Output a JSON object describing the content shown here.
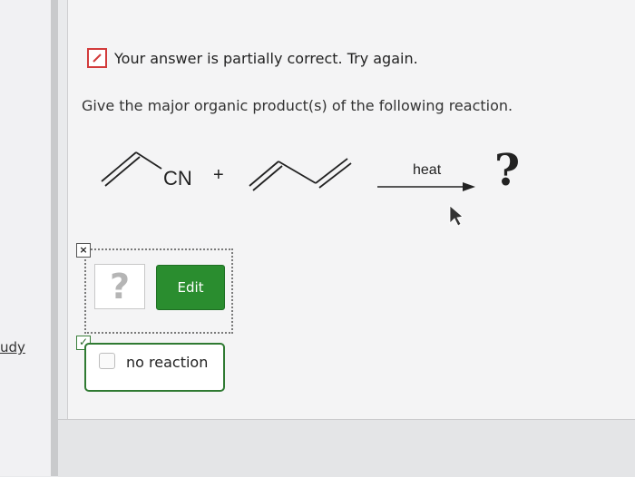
{
  "sidebar": {
    "fragment_text": "udy"
  },
  "status": {
    "message": "Your answer is partially correct.  Try again."
  },
  "question": {
    "text": "Give the major organic product(s) of the following reaction."
  },
  "reaction": {
    "group_label": "CN",
    "plus": "+",
    "arrow_condition": "heat",
    "product_placeholder": "?"
  },
  "answer_area": {
    "placeholder_symbol": "?",
    "edit_label": "Edit",
    "no_reaction_label": "no reaction"
  },
  "colors": {
    "edit_green": "#2a8d2f",
    "status_red": "#d23b3b"
  }
}
